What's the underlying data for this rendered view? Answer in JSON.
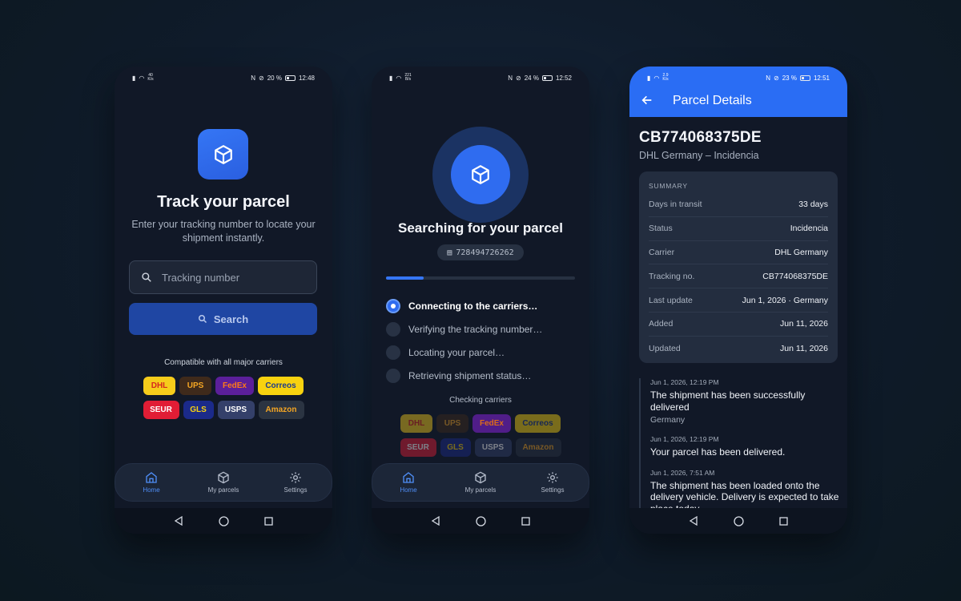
{
  "colors": {
    "accent": "#2f6cf0",
    "background": "#111827"
  },
  "status_bars": [
    {
      "speed_top": "40",
      "speed_bottom": "K/s",
      "battery": "20 %",
      "time": "12:48"
    },
    {
      "speed_top": "221",
      "speed_bottom": "B/s",
      "battery": "24 %",
      "time": "12:52"
    },
    {
      "speed_top": "2.9",
      "speed_bottom": "K/s",
      "battery": "23 %",
      "time": "12:51"
    }
  ],
  "home": {
    "icon": "package-icon",
    "title": "Track your parcel",
    "subtitle": "Enter your tracking number to locate your shipment instantly.",
    "input_placeholder": "Tracking number",
    "input_value": "",
    "search_label": "Search",
    "compat_label": "Compatible with all major carriers"
  },
  "carriers": [
    {
      "name": "DHL",
      "bg": "#f6cc1b",
      "fg": "#d5271f"
    },
    {
      "name": "UPS",
      "bg": "#3f2a1b",
      "fg": "#f5a623"
    },
    {
      "name": "FedEx",
      "bg": "#5b1f9a",
      "fg": "#ff7a18"
    },
    {
      "name": "Correos",
      "bg": "#f8d20f",
      "fg": "#1d3a8b"
    },
    {
      "name": "SEUR",
      "bg": "#e11d35",
      "fg": "#ffffff"
    },
    {
      "name": "GLS",
      "bg": "#1b2a8a",
      "fg": "#f8d20f"
    },
    {
      "name": "USPS",
      "bg": "#34406a",
      "fg": "#ffffff"
    },
    {
      "name": "Amazon",
      "bg": "#2b3442",
      "fg": "#f5a623"
    }
  ],
  "bottom_nav": [
    {
      "label": "Home",
      "icon": "home-icon"
    },
    {
      "label": "My parcels",
      "icon": "package-icon"
    },
    {
      "label": "Settings",
      "icon": "gear-icon"
    }
  ],
  "searching": {
    "title": "Searching for your parcel",
    "tracking_number": "728494726262",
    "progress": 0.2,
    "steps": [
      {
        "label": "Connecting to the carriers…",
        "active": true
      },
      {
        "label": "Verifying the tracking number…",
        "active": false
      },
      {
        "label": "Locating your parcel…",
        "active": false
      },
      {
        "label": "Retrieving shipment status…",
        "active": false
      }
    ],
    "checking_label": "Checking carriers"
  },
  "details": {
    "header_title": "Parcel Details",
    "tracking_id": "CB774068375DE",
    "carrier_status": "DHL Germany – Incidencia",
    "summary_label": "SUMMARY",
    "summary": [
      {
        "key": "Days in transit",
        "value": "33 days"
      },
      {
        "key": "Status",
        "value": "Incidencia"
      },
      {
        "key": "Carrier",
        "value": "DHL Germany"
      },
      {
        "key": "Tracking no.",
        "value": "CB774068375DE"
      },
      {
        "key": "Last update",
        "value": "Jun 1, 2026 · Germany"
      },
      {
        "key": "Added",
        "value": "Jun 11, 2026"
      },
      {
        "key": "Updated",
        "value": "Jun 11, 2026"
      }
    ],
    "events": [
      {
        "time": "Jun 1, 2026, 12:19 PM",
        "message": "The shipment has been successfully delivered",
        "location": "Germany"
      },
      {
        "time": "Jun 1, 2026, 12:19 PM",
        "message": "Your parcel has been delivered.",
        "location": ""
      },
      {
        "time": "Jun 1, 2026, 7:51 AM",
        "message": "The shipment has been loaded onto the delivery vehicle. Delivery is expected to take place today.",
        "location": ""
      }
    ]
  }
}
